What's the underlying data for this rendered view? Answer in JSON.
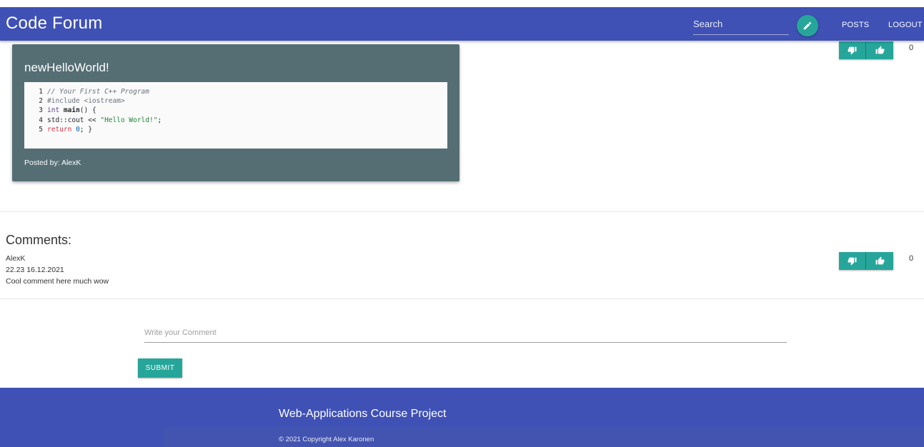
{
  "navbar": {
    "brand": "Code Forum",
    "search_placeholder": "Search",
    "edit_icon": "pencil-icon",
    "links": [
      "POSTS",
      "LOGOUT"
    ]
  },
  "post": {
    "title": "newHelloWorld!",
    "code_lines": [
      {
        "num": "1",
        "text": "// Your First C++ Program"
      },
      {
        "num": "2",
        "text": "#include <iostream>"
      },
      {
        "num": "3",
        "text": "int main() {"
      },
      {
        "num": "4",
        "text": "std::cout << \"Hello World!\";"
      },
      {
        "num": "5",
        "text": "return 0; }"
      }
    ],
    "posted_by": "Posted by: AlexK",
    "votes": {
      "count": "0",
      "dislike_icon": "thumb-down-icon",
      "like_icon": "thumb-up-icon"
    }
  },
  "comments": {
    "heading": "Comments:",
    "items": [
      {
        "author": "AlexK",
        "timestamp": "22.23 16.12.2021",
        "text": "Cool comment here much wow",
        "vote_count": "0"
      }
    ]
  },
  "comment_form": {
    "placeholder": "Write your Comment",
    "submit_label": "SUBMIT"
  },
  "footer": {
    "title": "Web-Applications Course Project",
    "copyright": "© 2021 Copyright Alex Karonen"
  },
  "colors": {
    "primary": "#3f51b5",
    "accent": "#26a69a",
    "card": "#546e74"
  }
}
